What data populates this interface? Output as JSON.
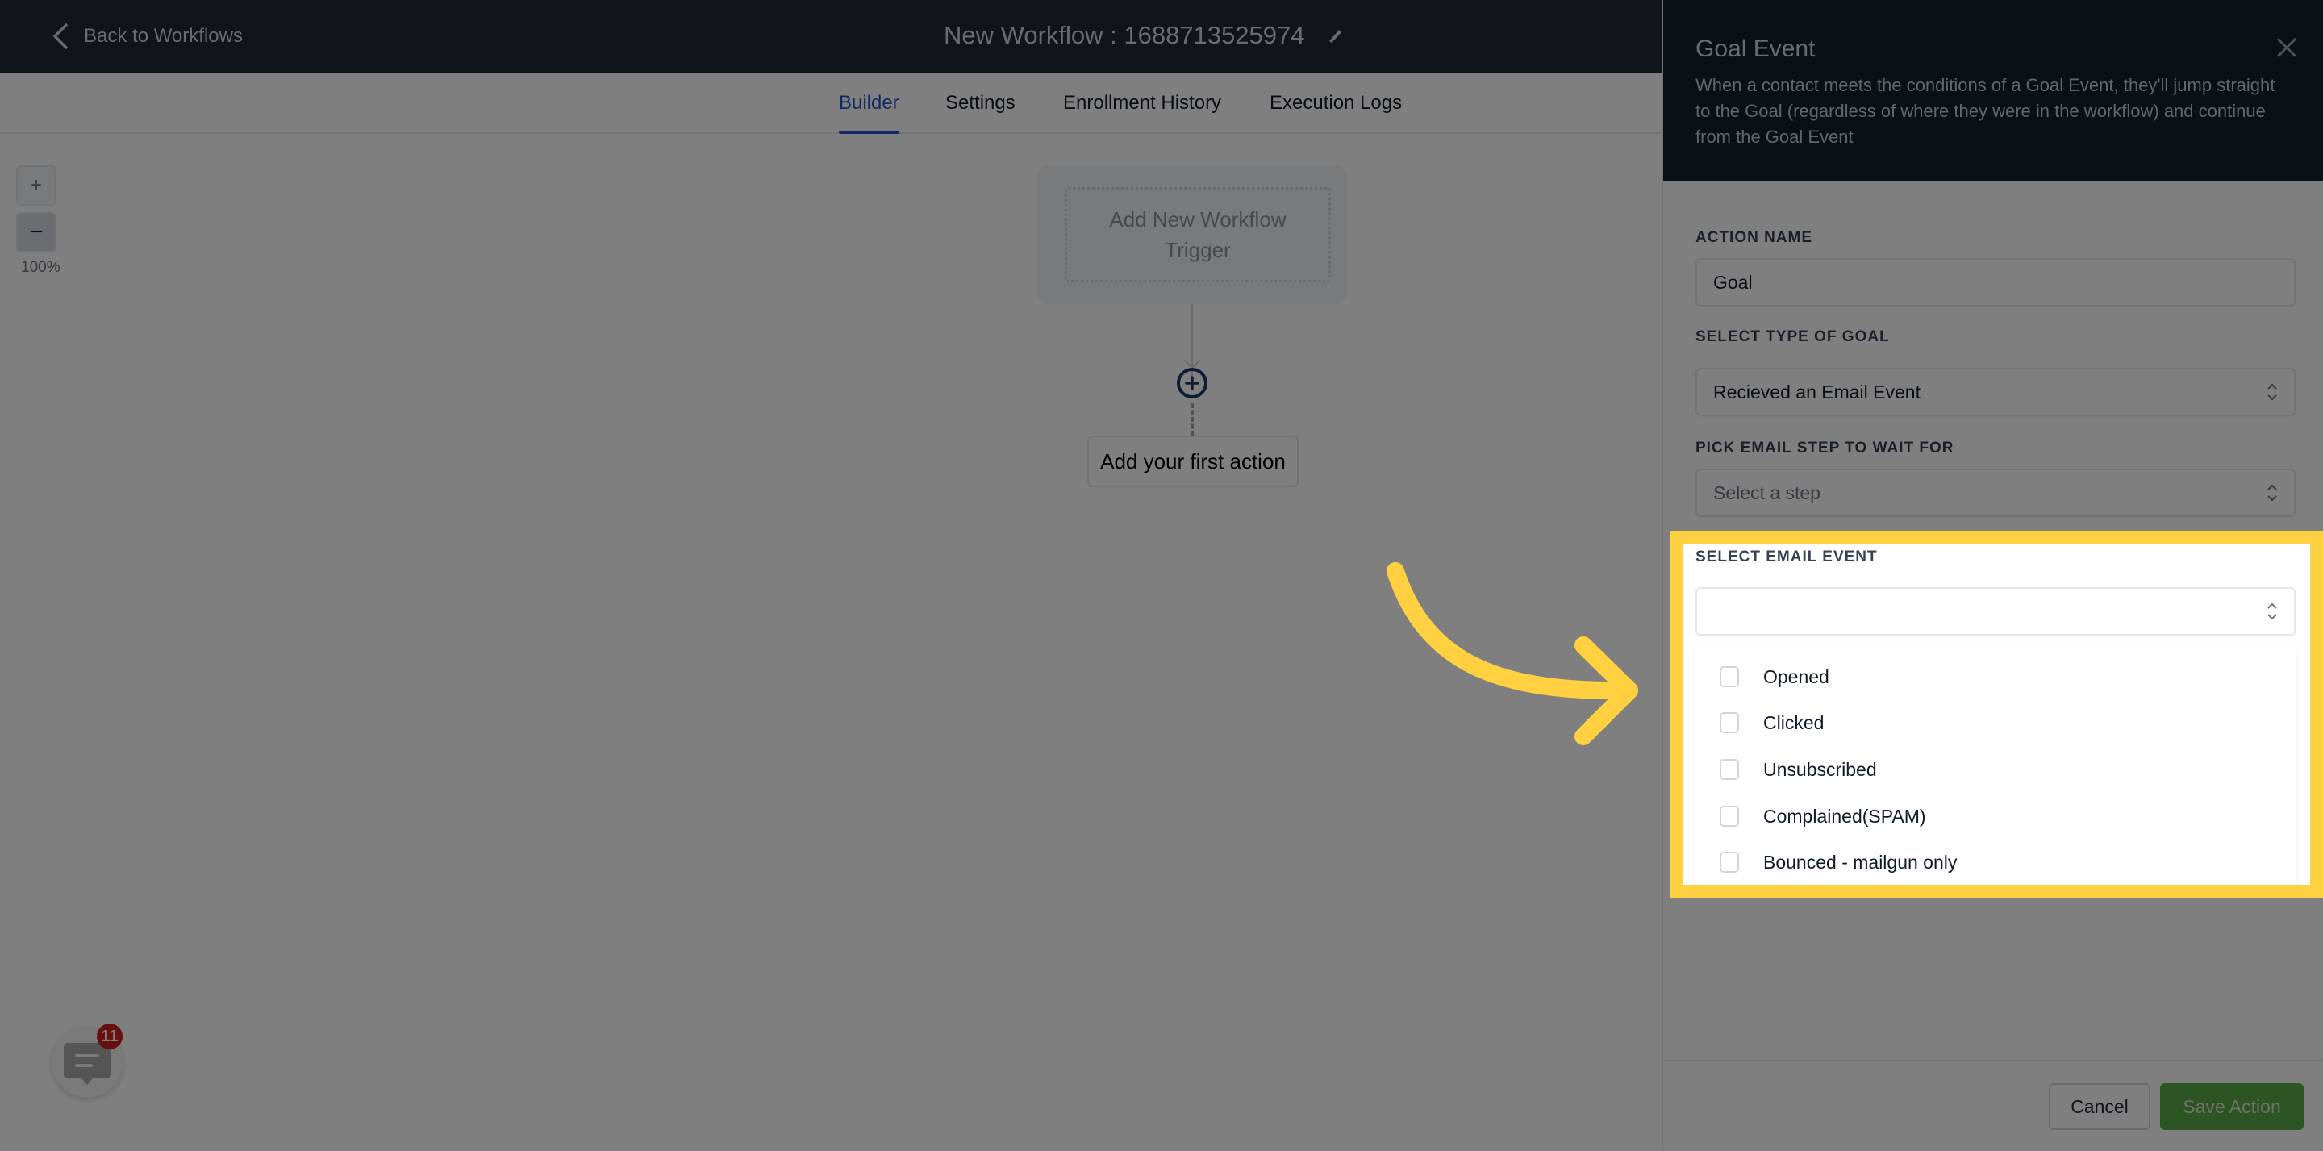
{
  "header": {
    "back_label": "Back to Workflows",
    "workflow_title": "New Workflow : 1688713525974"
  },
  "tabs": [
    {
      "label": "Builder",
      "active": true
    },
    {
      "label": "Settings",
      "active": false
    },
    {
      "label": "Enrollment History",
      "active": false
    },
    {
      "label": "Execution Logs",
      "active": false
    }
  ],
  "canvas": {
    "zoom_in": "+",
    "zoom_out": "−",
    "zoom_level": "100%",
    "trigger_label": "Add New Workflow Trigger",
    "first_action_label": "Add your first action"
  },
  "chat": {
    "badge_count": "11"
  },
  "panel": {
    "title": "Goal Event",
    "description": "When a contact meets the conditions of a Goal Event, they'll jump straight to the Goal (regardless of where they were in the workflow) and continue from the Goal Event",
    "fields": {
      "action_name": {
        "label": "ACTION NAME",
        "value": "Goal"
      },
      "goal_type": {
        "label": "SELECT TYPE OF GOAL",
        "value": "Recieved an Email Event"
      },
      "email_step": {
        "label": "PICK EMAIL STEP TO WAIT FOR",
        "placeholder": "Select a step"
      },
      "email_event": {
        "label": "SELECT EMAIL EVENT",
        "value": "",
        "options": [
          {
            "label": "Opened",
            "checked": false
          },
          {
            "label": "Clicked",
            "checked": false
          },
          {
            "label": "Unsubscribed",
            "checked": false
          },
          {
            "label": "Complained(SPAM)",
            "checked": false
          },
          {
            "label": "Bounced - mailgun only",
            "checked": false
          }
        ]
      }
    },
    "footer": {
      "cancel_label": "Cancel",
      "save_label": "Save Action"
    }
  },
  "colors": {
    "highlight": "#ffd140",
    "accent_blue": "#2554c7",
    "save_green": "#5aa947",
    "badge_red": "#d51f1f",
    "header_dark": "#222934"
  }
}
